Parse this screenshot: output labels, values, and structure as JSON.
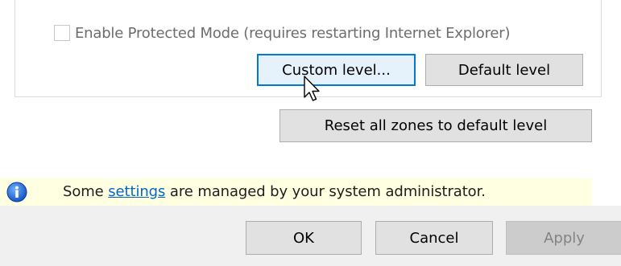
{
  "security_panel": {
    "protected_mode": {
      "label": "Enable Protected Mode (requires restarting Internet Explorer)",
      "checked": false
    },
    "buttons": {
      "custom_level": "Custom level...",
      "default_level": "Default level",
      "reset_all_zones": "Reset all zones to default level"
    }
  },
  "info_bar": {
    "icon": "info-icon",
    "text_before": "Some ",
    "link_text": "settings",
    "text_after": " are managed by your system administrator."
  },
  "dialog_buttons": {
    "ok": "OK",
    "cancel": "Cancel",
    "apply": "Apply"
  },
  "colors": {
    "accent": "#0078d7",
    "info_background": "#ffffe1",
    "link": "#0066cc",
    "footer_background": "#f0f0f0"
  }
}
